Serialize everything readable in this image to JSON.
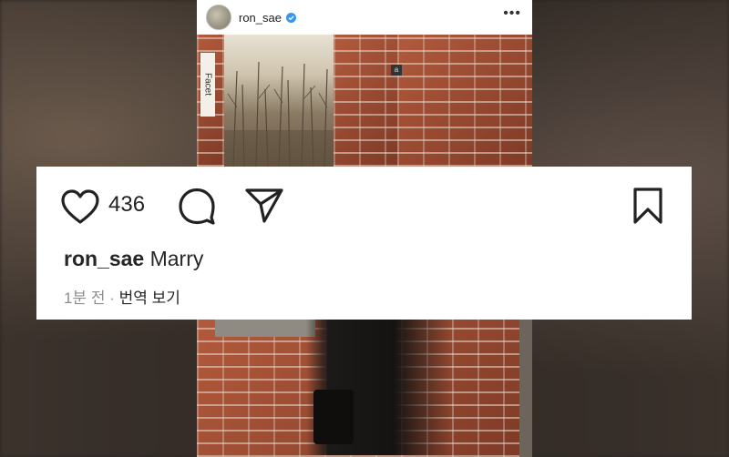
{
  "post": {
    "username": "ron_sae",
    "photo_tag": "Facet",
    "photo_badge": "a",
    "more_label": "•••"
  },
  "card": {
    "like_count": "436",
    "caption_user": "ron_sae",
    "caption_text": "Marry",
    "time": "1분 전",
    "separator": "·",
    "translate_label": "번역 보기"
  },
  "colors": {
    "verified": "#3897f0",
    "brick": "#9e4c33",
    "meta": "#8e8e8e"
  }
}
